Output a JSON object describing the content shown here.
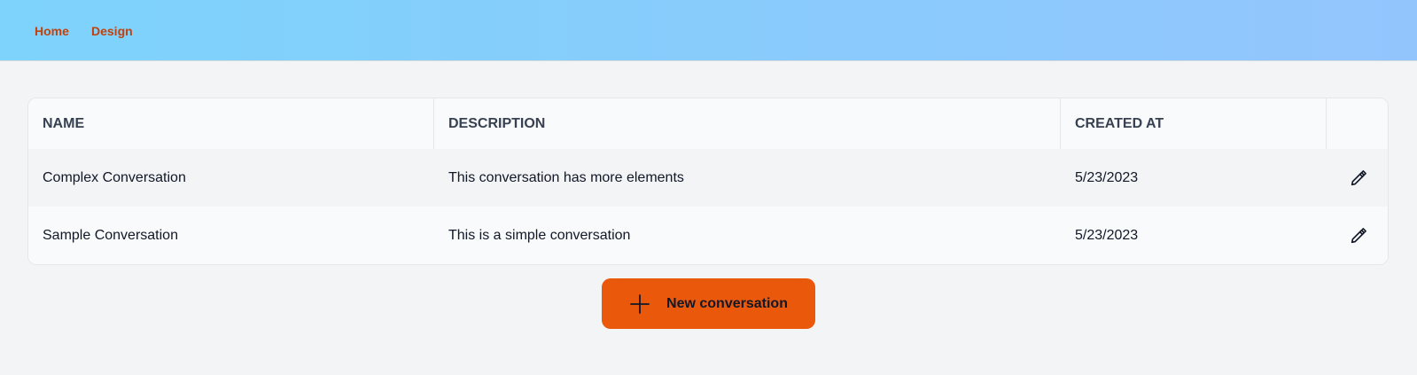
{
  "nav": {
    "items": [
      {
        "label": "Home"
      },
      {
        "label": "Design"
      }
    ],
    "link_color": "#c2410c"
  },
  "table": {
    "headers": {
      "name": "NAME",
      "description": "DESCRIPTION",
      "created_at": "CREATED AT"
    },
    "rows": [
      {
        "name": "Complex Conversation",
        "description": "This conversation has more elements",
        "created_at": "5/23/2023",
        "action_icon": "pencil-icon"
      },
      {
        "name": "Sample Conversation",
        "description": "This is a simple conversation",
        "created_at": "5/23/2023",
        "action_icon": "pencil-icon"
      }
    ]
  },
  "actions": {
    "new_conversation_label": "New conversation",
    "new_conversation_icon": "plus-icon",
    "accent_color": "#ea580c"
  }
}
